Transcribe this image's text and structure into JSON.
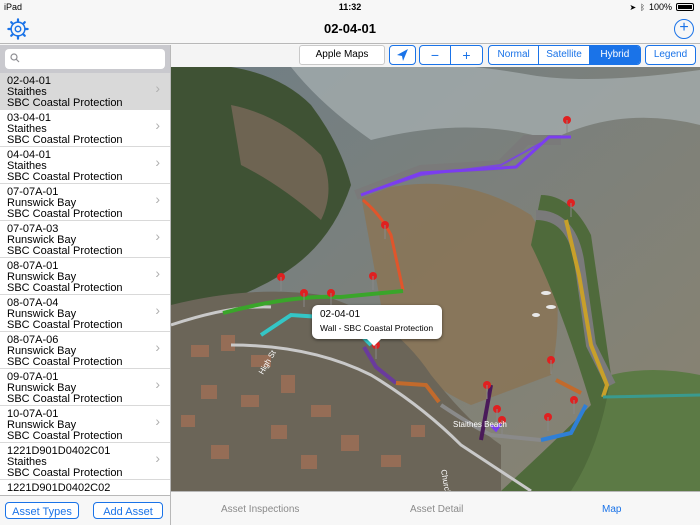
{
  "status": {
    "carrier": "iPad",
    "time": "11:32",
    "battery": "100%"
  },
  "nav": {
    "title": "02-04-01"
  },
  "search": {
    "placeholder": ""
  },
  "assets": [
    {
      "id": "02-04-01",
      "location": "Staithes",
      "owner": "SBC Coastal Protection"
    },
    {
      "id": "03-04-01",
      "location": "Staithes",
      "owner": "SBC Coastal Protection"
    },
    {
      "id": "04-04-01",
      "location": "Staithes",
      "owner": "SBC Coastal Protection"
    },
    {
      "id": "07-07A-01",
      "location": "Runswick Bay",
      "owner": "SBC Coastal Protection"
    },
    {
      "id": "07-07A-03",
      "location": "Runswick Bay",
      "owner": "SBC Coastal Protection"
    },
    {
      "id": "08-07A-01",
      "location": "Runswick Bay",
      "owner": "SBC Coastal Protection"
    },
    {
      "id": "08-07A-04",
      "location": "Runswick Bay",
      "owner": "SBC Coastal Protection"
    },
    {
      "id": "08-07A-06",
      "location": "Runswick Bay",
      "owner": "SBC Coastal Protection"
    },
    {
      "id": "09-07A-01",
      "location": "Runswick Bay",
      "owner": "SBC Coastal Protection"
    },
    {
      "id": "10-07A-01",
      "location": "Runswick Bay",
      "owner": "SBC Coastal Protection"
    },
    {
      "id": "1221D901D0402C01",
      "location": "Staithes",
      "owner": "SBC Coastal Protection"
    },
    {
      "id": "1221D901D0402C02",
      "location": "",
      "owner": ""
    }
  ],
  "sidebar_buttons": {
    "asset_types": "Asset Types",
    "add_asset": "Add Asset"
  },
  "map_toolbar": {
    "apple_maps": "Apple Maps",
    "zoom_out": "−",
    "zoom_in": "+",
    "types": [
      "Normal",
      "Satellite",
      "Hybrid"
    ],
    "selected_type": "Hybrid",
    "legend": "Legend"
  },
  "callout": {
    "title": "02-04-01",
    "subtitle": "Wall - SBC Coastal Protection"
  },
  "map_labels": {
    "street1": "High St",
    "street2": "Church St",
    "place": "Staithes Beach"
  },
  "tabs": [
    "Asset Inspections",
    "Asset Detail",
    "Map"
  ],
  "active_tab": "Map",
  "colors": {
    "accent": "#1a73e8"
  }
}
